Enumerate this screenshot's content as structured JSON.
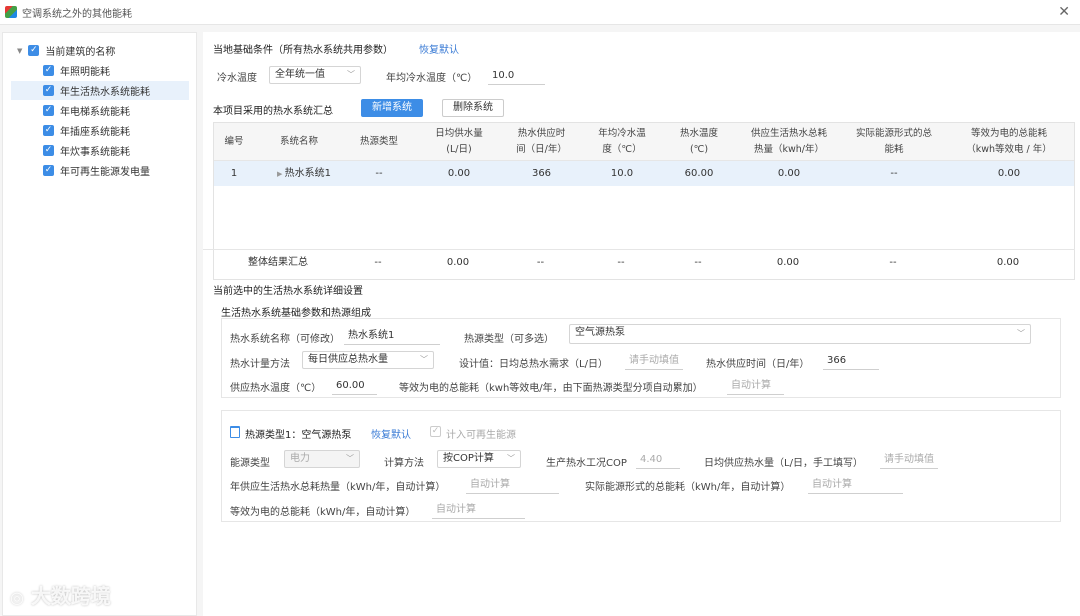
{
  "window": {
    "title": "空调系统之外的其他能耗",
    "close": "✕"
  },
  "tree": {
    "root": "当前建筑的名称",
    "items": [
      "年照明能耗",
      "年生活热水系统能耗",
      "年电梯系统能耗",
      "年插座系统能耗",
      "年炊事系统能耗",
      "年可再生能源发电量"
    ],
    "selected_index": 1
  },
  "basic": {
    "title": "当地基础条件（所有热水系统共用参数）",
    "reset": "恢复默认",
    "water_temp_label": "冷水温度",
    "water_temp_value": "全年统一值",
    "annual_temp_label": "年均冷水温度（℃）",
    "annual_temp_value": "10.0"
  },
  "summary": {
    "title": "本项目采用的热水系统汇总",
    "add_btn": "新增系统",
    "del_btn": "删除系统",
    "headers": [
      "编号",
      "系统名称",
      "热源类型",
      "日均供水量\n(L/日)",
      "热水供应时\n间（日/年）",
      "年均冷水温\n度（℃）",
      "热水温度\n(℃)",
      "供应生活热水总耗\n热量（kwh/年）",
      "实际能源形式的总\n能耗",
      "等效为电的总能耗\n（kwh等效电 / 年）"
    ],
    "row": [
      "1",
      "热水系统1",
      "--",
      "0.00",
      "366",
      "10.0",
      "60.00",
      "0.00",
      "--",
      "0.00"
    ],
    "footer": [
      "整体结果汇总",
      "--",
      "0.00",
      "--",
      "--",
      "--",
      "0.00",
      "--",
      "0.00"
    ]
  },
  "detail": {
    "title": "当前选中的生活热水系统详细设置",
    "sub": "生活热水系统基础参数和热源组成",
    "name_label": "热水系统名称（可修改）",
    "name_value": "热水系统1",
    "source_label": "热源类型（可多选）",
    "source_value": "空气源热泵",
    "calc_label": "热水计量方法",
    "calc_value": "每日供应总热水量",
    "design_label": "设计值：日均总热水需求（L/日）",
    "design_ph": "请手动填值",
    "supply_time_label": "热水供应时间（日/年）",
    "supply_time_value": "366",
    "water_temp_label": "供应热水温度（℃）",
    "water_temp_value": "60.00",
    "equiv_label": "等效为电的总能耗（kwh等效电/年，由下面热源类型分项自动累加）",
    "equiv_ph": "自动计算"
  },
  "source": {
    "title": "热源类型1：空气源热泵",
    "reset": "恢复默认",
    "renew_label": "计入可再生能源",
    "energy_label": "能源类型",
    "energy_value": "电力",
    "method_label": "计算方法",
    "method_value": "按COP计算",
    "cop_label": "生产热水工况COP",
    "cop_value": "4.40",
    "daily_label": "日均供应热水量（L/日，手工填写）",
    "daily_ph": "请手动填值",
    "annual_label": "年供应生活热水总耗热量（kWh/年，自动计算）",
    "annual_ph": "自动计算",
    "actual_label": "实际能源形式的总能耗（kWh/年，自动计算）",
    "actual_ph": "自动计算",
    "equiv_label": "等效为电的总能耗（kWh/年，自动计算）",
    "equiv_ph": "自动计算"
  },
  "watermark": "大数跨境",
  "colors": {
    "accent": "#3d8de6",
    "selected_row": "#e8f1fb"
  }
}
